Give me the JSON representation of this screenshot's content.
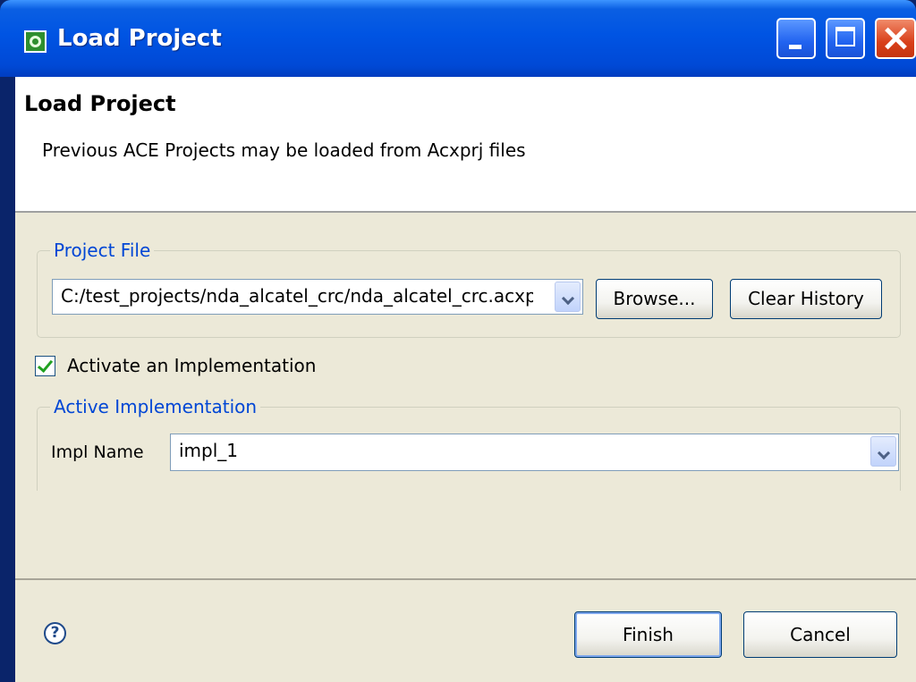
{
  "window": {
    "title": "Load Project",
    "icon": "eclipse-app-icon"
  },
  "titlebar_buttons": {
    "minimize": "minimize-icon",
    "maximize": "maximize-icon",
    "close": "close-icon"
  },
  "header": {
    "title": "Load Project",
    "description": "Previous ACE Projects may be loaded from Acxprj files"
  },
  "project_file": {
    "legend": "Project File",
    "value": "C:/test_projects/nda_alcatel_crc/nda_alcatel_crc.acxprj",
    "browse_label": "Browse...",
    "clear_history_label": "Clear History"
  },
  "activate": {
    "label": "Activate an Implementation",
    "checked": true
  },
  "active_impl": {
    "legend": "Active Implementation",
    "name_label": "Impl Name",
    "value": "impl_1"
  },
  "footer": {
    "help_glyph": "?",
    "finish_label": "Finish",
    "cancel_label": "Cancel"
  },
  "colors": {
    "titlebar": "#0054e3",
    "dialog_bg": "#ece9d8",
    "legend": "#0046d5"
  }
}
